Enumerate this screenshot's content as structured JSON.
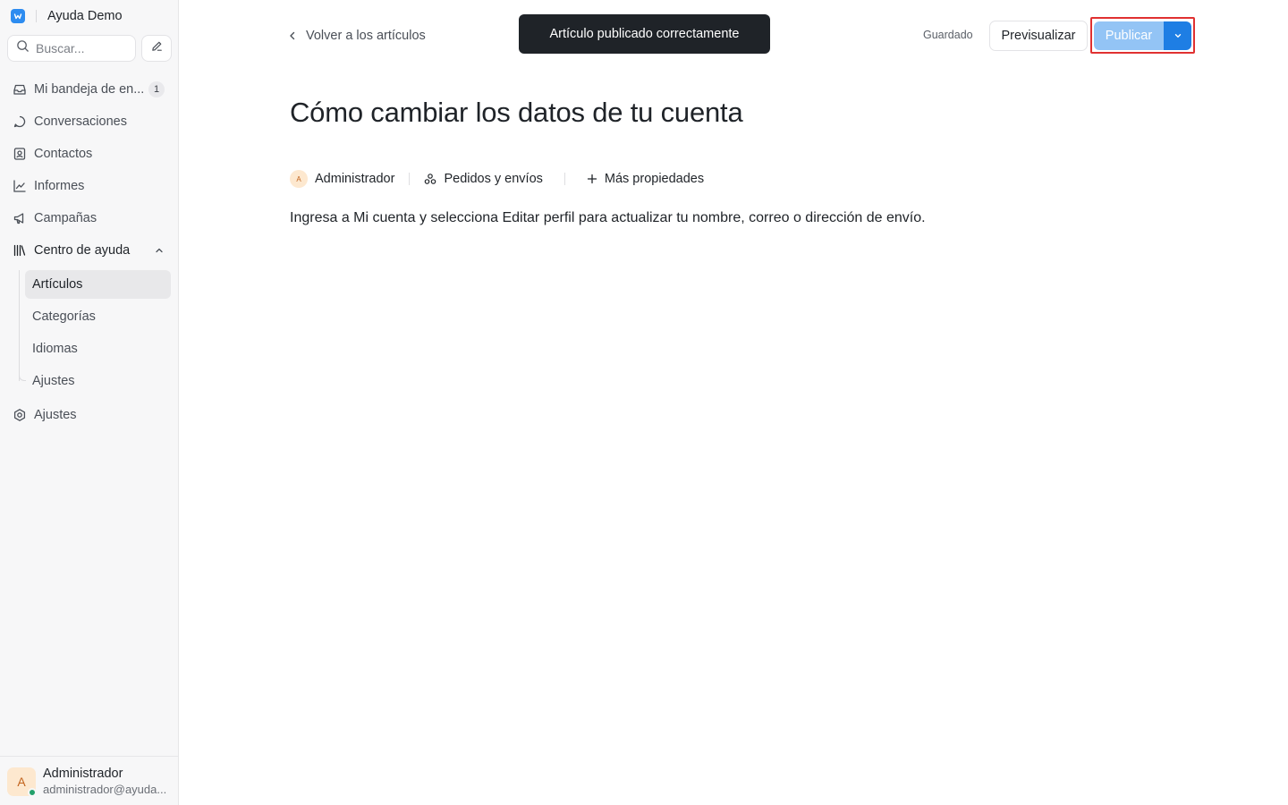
{
  "sidebar": {
    "brand": "Ayuda Demo",
    "search_placeholder": "Buscar...",
    "nav": [
      {
        "label": "Mi bandeja de en...",
        "badge": "1",
        "icon": "inbox-icon"
      },
      {
        "label": "Conversaciones",
        "icon": "chat-bubble-icon"
      },
      {
        "label": "Contactos",
        "icon": "contact-card-icon"
      },
      {
        "label": "Informes",
        "icon": "chart-line-icon"
      },
      {
        "label": "Campañas",
        "icon": "megaphone-icon"
      },
      {
        "label": "Centro de ayuda",
        "icon": "library-icon"
      }
    ],
    "help_center_items": [
      {
        "label": "Artículos",
        "active": true
      },
      {
        "label": "Categorías"
      },
      {
        "label": "Idiomas"
      },
      {
        "label": "Ajustes"
      }
    ],
    "settings": {
      "label": "Ajustes",
      "icon": "gear-icon"
    },
    "user": {
      "initial": "A",
      "name": "Administrador",
      "email": "administrador@ayuda..."
    }
  },
  "header": {
    "back_label": "Volver a los artículos",
    "toast": "Artículo publicado correctamente",
    "status": "Guardado",
    "preview_label": "Previsualizar",
    "publish_label": "Publicar"
  },
  "article": {
    "title": "Cómo cambiar los datos de tu cuenta",
    "author_initial": "A",
    "author": "Administrador",
    "category": "Pedidos y envíos",
    "more_properties": "Más propiedades",
    "body": "Ingresa a Mi cuenta y selecciona Editar perfil para actualizar tu nombre, correo o dirección de envío."
  },
  "colors": {
    "accent": "#1e7ee4",
    "publish_disabled": "#93c4f5",
    "toast_bg": "#1f2328",
    "highlight": "#e03131"
  }
}
